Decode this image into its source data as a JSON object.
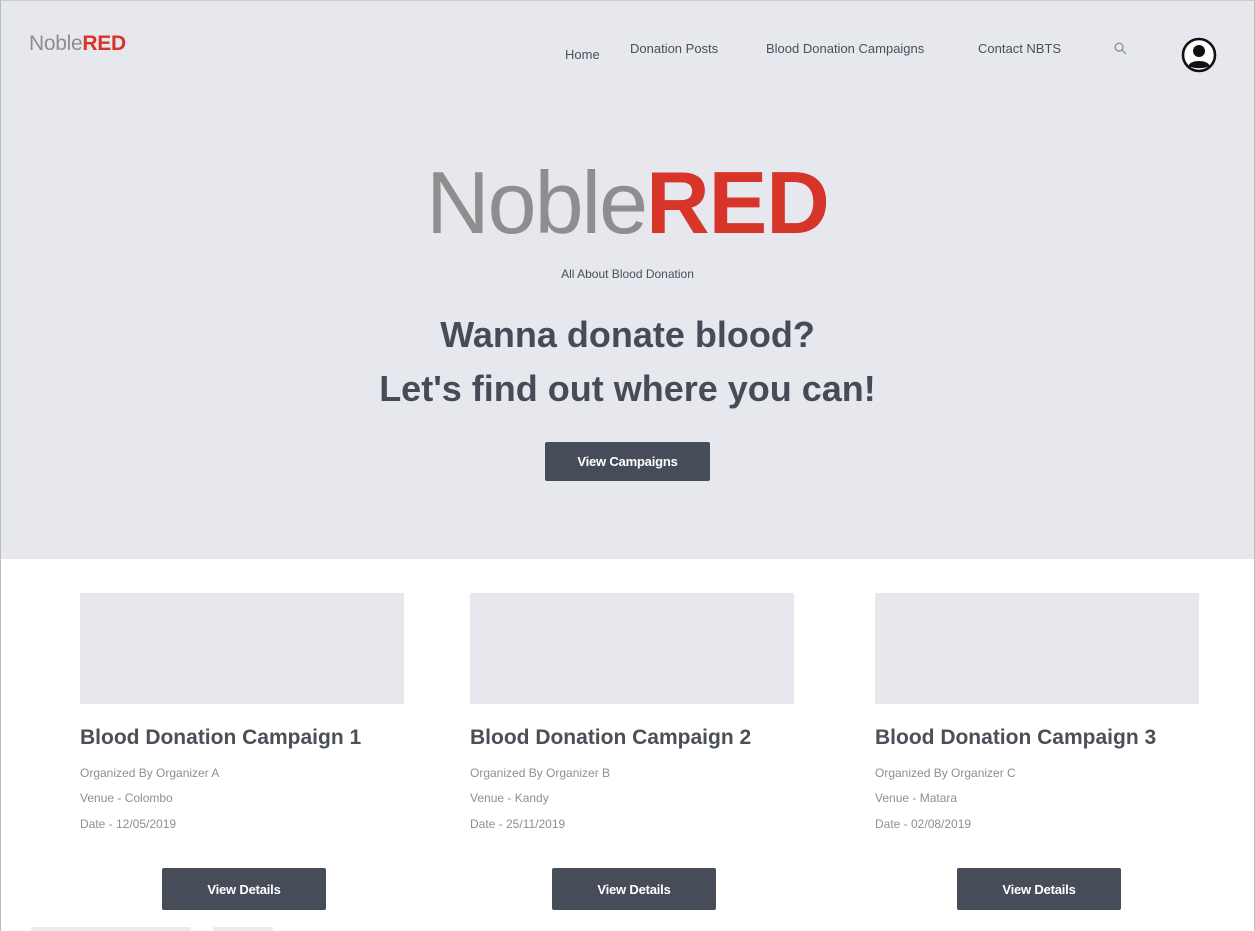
{
  "brand": {
    "noble": "Noble",
    "red": "RED"
  },
  "nav": {
    "items": [
      {
        "label": "Home"
      },
      {
        "label": "Donation Posts"
      },
      {
        "label": "Blood Donation Campaigns"
      },
      {
        "label": "Contact NBTS"
      }
    ],
    "search_icon": "search-icon",
    "profile_icon": "user-circle-icon"
  },
  "hero": {
    "tagline": "All About Blood Donation",
    "headline_line1": "Wanna donate blood?",
    "headline_line2": "Let's find out where you can!",
    "cta_label": "View Campaigns"
  },
  "campaigns": [
    {
      "title": "Blood Donation Campaign 1",
      "organizer": "Organized By Organizer A",
      "venue": "Venue - Colombo",
      "date": "Date - 12/05/2019",
      "button_label": "View Details"
    },
    {
      "title": "Blood Donation Campaign 2",
      "organizer": "Organized By Organizer B",
      "venue": "Venue - Kandy",
      "date": "Date - 25/11/2019",
      "button_label": "View Details"
    },
    {
      "title": "Blood Donation Campaign 3",
      "organizer": "Organized By Organizer C",
      "venue": "Venue - Matara",
      "date": "Date - 02/08/2019",
      "button_label": "View Details"
    }
  ],
  "colors": {
    "brand_red": "#d7342a",
    "brand_gray": "#8e8e8e",
    "hero_background": "#e6e8ee",
    "button_background": "#474d58"
  }
}
